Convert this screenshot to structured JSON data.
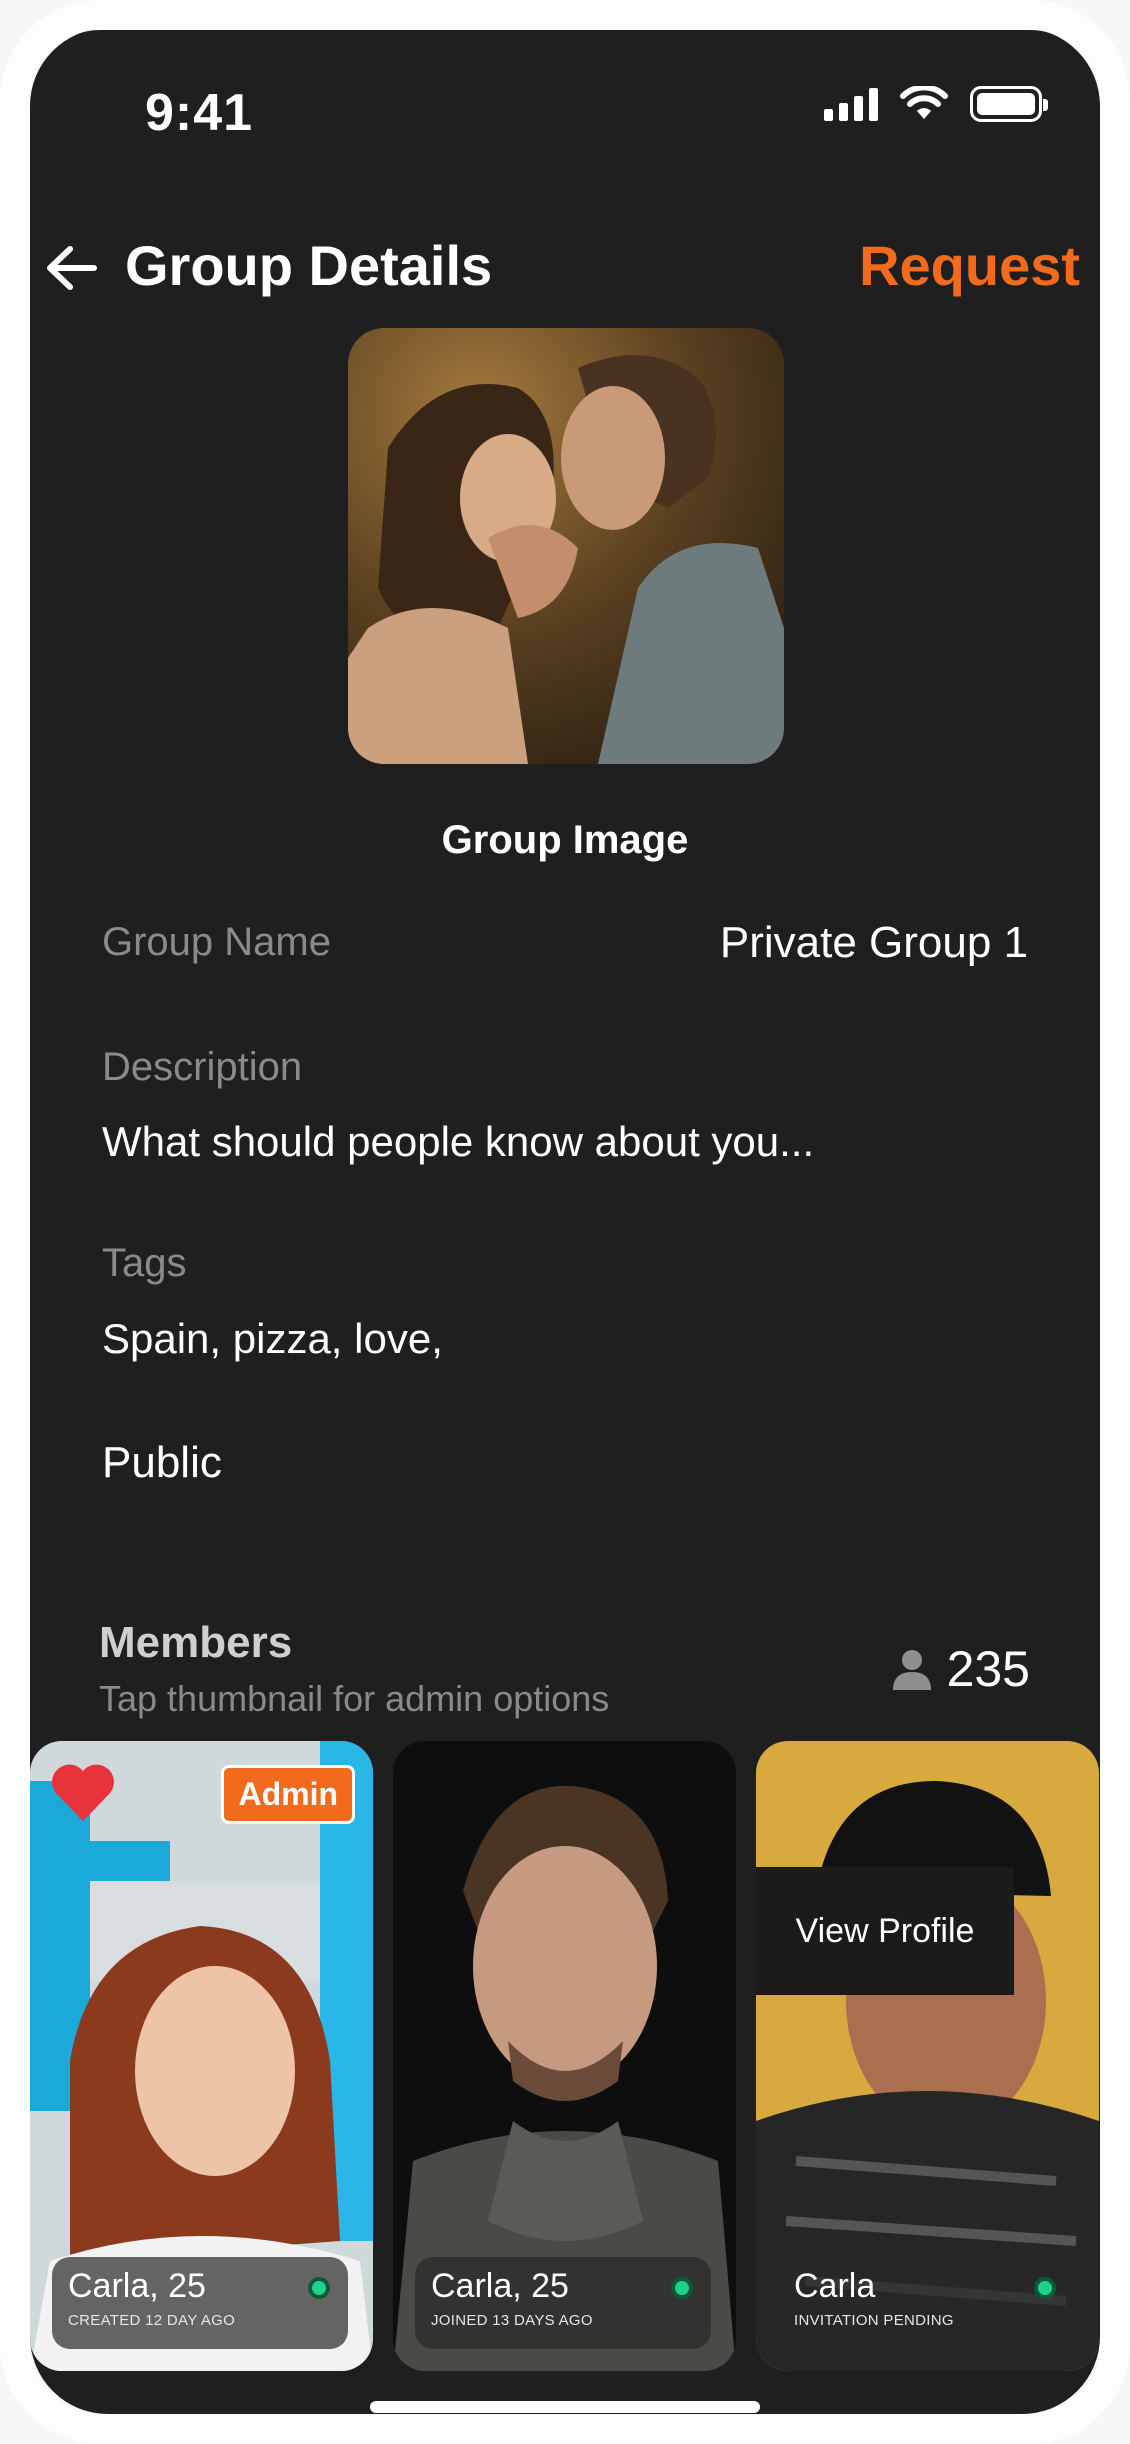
{
  "status_bar": {
    "time": "9:41",
    "icons": [
      "signal-icon",
      "wifi-icon",
      "battery-icon"
    ]
  },
  "header": {
    "title": "Group Details",
    "action": "Request",
    "back_icon": "arrow-left-icon"
  },
  "group_image": {
    "label": "Group Image"
  },
  "fields": {
    "group_name_label": "Group Name",
    "group_name_value": "Private Group 1",
    "description_label": "Description",
    "description_value": "What should people know about you...",
    "tags_label": "Tags",
    "tags_value": "Spain, pizza, love,",
    "visibility": "Public"
  },
  "members": {
    "title": "Members",
    "subtitle": "Tap thumbnail for admin options",
    "count": "235",
    "cards": [
      {
        "name": "Carla, 25",
        "meta": "CREATED 12 DAY AGO",
        "badge": "Admin",
        "favorite": true
      },
      {
        "name": "Carla, 25",
        "meta": "JOINED 13 DAYS AGO"
      },
      {
        "name": "Carla",
        "meta": "INVITATION PENDING",
        "overlay": "View Profile"
      }
    ]
  },
  "colors": {
    "accent": "#f26a1b",
    "background": "#1f1f1f",
    "online": "#1fd08a",
    "heart": "#e8333b"
  }
}
